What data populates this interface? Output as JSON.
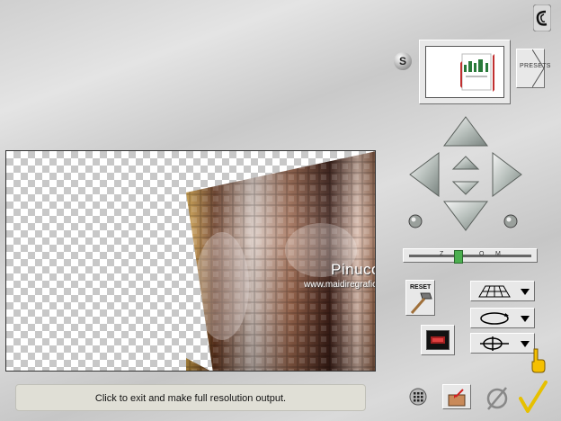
{
  "status_bar": {
    "message": "Click to exit and make full resolution output."
  },
  "settings": {
    "s_label": "S"
  },
  "presets": {
    "label": "PRESETS"
  },
  "reset": {
    "label": "RESET"
  },
  "watermark": {
    "name": "Pinuccia",
    "url": "www.maidiregrafica.eu"
  },
  "zoom_slider": {
    "ticks": [
      "Z",
      "O",
      "M"
    ],
    "value_fraction": 0.4
  },
  "dropdowns": [
    {
      "name": "perspective-grid-dropdown",
      "icon": "grid-plane-icon"
    },
    {
      "name": "rotate-dropdown",
      "icon": "rotate-ellipse-icon"
    },
    {
      "name": "spin-dropdown",
      "icon": "spin-axis-icon"
    }
  ],
  "nav_arrows": [
    "up-arrow",
    "down-arrow",
    "left-arrow",
    "right-arrow",
    "tilt-up-arrow",
    "tilt-down-arrow",
    "rotate-left-knob",
    "rotate-right-knob"
  ],
  "bottom_toolbar": [
    "grid-icon",
    "export-image-icon",
    "cancel-icon",
    "ok-checkmark-icon"
  ],
  "colors": {
    "accent": "#4caf50",
    "panel": "#d6d6d6",
    "check_yellow": "#f5d000"
  }
}
